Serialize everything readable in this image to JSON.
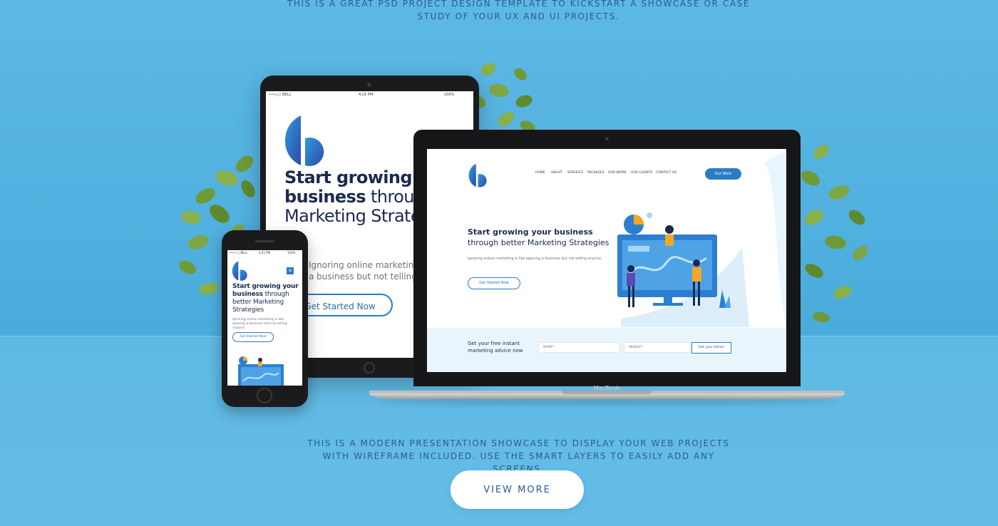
{
  "header": {
    "intro_text": "THIS IS A GREAT PSD PROJECT DESIGN TEMPLATE TO KICKSTART A SHOWCASE OR CASE STUDY OF YOUR UX AND UI PROJECTS."
  },
  "footer": {
    "description": "THIS IS A MODERN PRESENTATION SHOWCASE TO DISPLAY YOUR WEB PROJECTS WITH WIREFRAME INCLUDED. USE THE SMART LAYERS TO EASILY ADD ANY SCREENS.",
    "view_more_label": "VIEW MORE"
  },
  "colors": {
    "background": "#56b3e0",
    "text_primary": "#2d5c91",
    "accent": "#2b7cc6",
    "heading": "#1b2a4e"
  },
  "tablet": {
    "status_carrier": "•••○○ BELL",
    "status_time": "4:21 PM",
    "status_battery": "100%",
    "heading_bold": "Start growing your business",
    "heading_light": " through better Marketing Strategies",
    "body": "Ignoring online marketing is like opening a business but not telling anyone.",
    "cta": "Get Started Now"
  },
  "laptop": {
    "brand": "MacBook",
    "nav": [
      "HOME",
      "ABOUT",
      "SERVICES",
      "PACKAGES",
      "OUR WORK",
      "OUR CLIENTS",
      "CONTACT US"
    ],
    "our_work_button": "Our Work",
    "heading_bold": "Start growing your business",
    "heading_light": "through better Marketing Strategies",
    "body": "Ignoring online marketing is like opening a business but not telling anyone.",
    "cta": "Get Started Now",
    "form_title": "Get your free instant marketing advice now",
    "name_placeholder": "NAME*",
    "mobile_placeholder": "MOBILE*",
    "submit": "Get your Advice"
  },
  "phone": {
    "status_carrier": "•••○○ BELL",
    "status_time": "4:21 PM",
    "status_battery": "100%",
    "menu_icon": "menu-icon",
    "heading_bold": "Start growing your business",
    "heading_light": " through better Marketing Strategies",
    "body": "Ignoring online marketing is like opening a business but not telling anyone.",
    "cta": "Get Started Now"
  }
}
